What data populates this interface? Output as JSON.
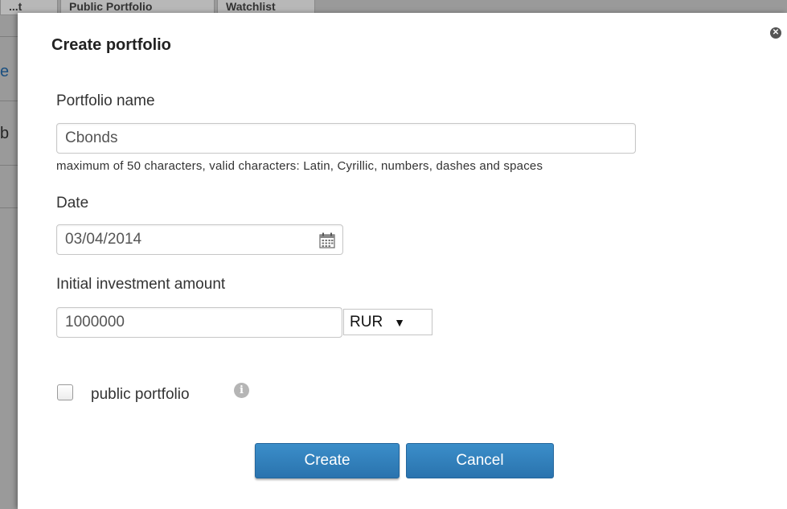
{
  "background": {
    "tabs": [
      "...t",
      "Public Portfolio",
      "Watchlist"
    ],
    "edge_letters": [
      "e",
      "b"
    ]
  },
  "dialog": {
    "title": "Create portfolio",
    "close_icon": "close-icon",
    "fields": {
      "portfolio_name": {
        "label": "Portfolio name",
        "value": "Cbonds",
        "hint": "maximum of 50 characters, valid characters: Latin, Cyrillic, numbers, dashes and spaces"
      },
      "date": {
        "label": "Date",
        "value": "03/04/2014",
        "icon": "calendar-icon"
      },
      "amount": {
        "label": "Initial investment amount",
        "value": "1000000",
        "currency": "RUR",
        "caret": "▼"
      }
    },
    "public_checkbox": {
      "label": "public portfolio",
      "checked": false,
      "info_icon": "info-icon"
    },
    "buttons": {
      "create": "Create",
      "cancel": "Cancel"
    }
  },
  "colors": {
    "button": "#2f7fbc",
    "overlay": "#9a9a9a"
  }
}
